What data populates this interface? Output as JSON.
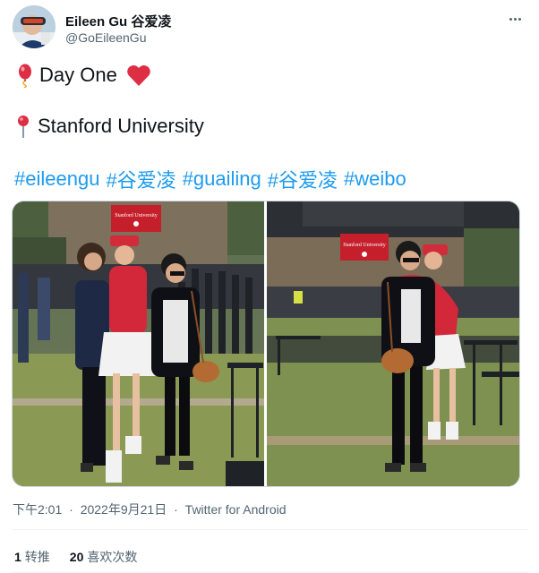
{
  "tweet": {
    "author": {
      "name": "Eileen Gu 谷爱凌",
      "handle": "@GoEileenGu"
    },
    "lines": {
      "line1": {
        "icon": "red-balloon-icon",
        "text": "Day One",
        "end_icon": "red-heart-icon"
      },
      "line2": {
        "icon": "round-pushpin-icon",
        "text": "Stanford University"
      }
    },
    "hashtags": [
      "#eileengu",
      "#谷爱凌",
      "#guailing",
      "#谷爱凌",
      "#weibo"
    ],
    "photos": [
      {
        "sign_text": "Stanford University"
      },
      {
        "sign_text": "Stanford University"
      }
    ],
    "meta": {
      "time": "下午2:01",
      "separator": "·",
      "date": "2022年9月21日",
      "source": "Twitter for Android"
    },
    "stats": {
      "retweets_count": "1",
      "retweets_label": "转推",
      "likes_count": "20",
      "likes_label": "喜欢次数"
    }
  },
  "colors": {
    "link": "#1d9bf0",
    "secondary_text": "#536471",
    "primary_text": "#0f1419",
    "border": "#cfd9de"
  }
}
